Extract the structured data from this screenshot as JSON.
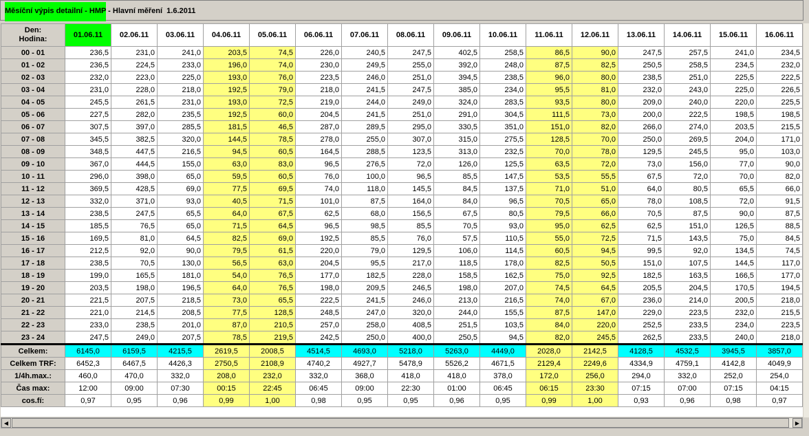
{
  "window": {
    "title_hl": "Měsíční výpis detailní - HMP",
    "title_rest": " - Hlavní měření  1.6.2011"
  },
  "corner": {
    "line1": "Den:",
    "line2": "Hodina:"
  },
  "dates": [
    "01.06.11",
    "02.06.11",
    "03.06.11",
    "04.06.11",
    "05.06.11",
    "06.06.11",
    "07.06.11",
    "08.06.11",
    "09.06.11",
    "10.06.11",
    "11.06.11",
    "12.06.11",
    "13.06.11",
    "14.06.11",
    "15.06.11",
    "16.06.11"
  ],
  "highlight": {
    "today_index": 0,
    "weekend_indices": [
      3,
      4,
      10,
      11
    ]
  },
  "colors": {
    "today": "#00ff00",
    "weekend": "#ffff80",
    "summary": "#00ffff"
  },
  "hours": [
    "00 - 01",
    "01 - 02",
    "02 - 03",
    "03 - 04",
    "04 - 05",
    "05 - 06",
    "06 - 07",
    "07 - 08",
    "08 - 09",
    "09 - 10",
    "10 - 11",
    "11 - 12",
    "12 - 13",
    "13 - 14",
    "14 - 15",
    "15 - 16",
    "16 - 17",
    "17 - 18",
    "18 - 19",
    "19 - 20",
    "20 - 21",
    "21 - 22",
    "22 - 23",
    "23 - 24"
  ],
  "values": [
    [
      "236,5",
      "231,0",
      "241,0",
      "203,5",
      "74,5",
      "226,0",
      "240,5",
      "247,5",
      "402,5",
      "258,5",
      "86,5",
      "90,0",
      "247,5",
      "257,5",
      "241,0",
      "234,5"
    ],
    [
      "236,5",
      "224,5",
      "233,0",
      "196,0",
      "74,0",
      "230,0",
      "249,5",
      "255,0",
      "392,0",
      "248,0",
      "87,5",
      "82,5",
      "250,5",
      "258,5",
      "234,5",
      "232,0"
    ],
    [
      "232,0",
      "223,0",
      "225,0",
      "193,0",
      "76,0",
      "223,5",
      "246,0",
      "251,0",
      "394,5",
      "238,5",
      "96,0",
      "80,0",
      "238,5",
      "251,0",
      "225,5",
      "222,5"
    ],
    [
      "231,0",
      "228,0",
      "218,0",
      "192,5",
      "79,0",
      "218,0",
      "241,5",
      "247,5",
      "385,0",
      "234,0",
      "95,5",
      "81,0",
      "232,0",
      "243,0",
      "225,0",
      "226,5"
    ],
    [
      "245,5",
      "261,5",
      "231,0",
      "193,0",
      "72,5",
      "219,0",
      "244,0",
      "249,0",
      "324,0",
      "283,5",
      "93,5",
      "80,0",
      "209,0",
      "240,0",
      "220,0",
      "225,5"
    ],
    [
      "227,5",
      "282,0",
      "235,5",
      "192,5",
      "60,0",
      "204,5",
      "241,5",
      "251,0",
      "291,0",
      "304,5",
      "111,5",
      "73,0",
      "200,0",
      "222,5",
      "198,5",
      "198,5"
    ],
    [
      "307,5",
      "397,0",
      "285,5",
      "181,5",
      "46,5",
      "287,0",
      "289,5",
      "295,0",
      "330,5",
      "351,0",
      "151,0",
      "82,0",
      "266,0",
      "274,0",
      "203,5",
      "215,5"
    ],
    [
      "345,5",
      "382,5",
      "320,0",
      "144,5",
      "78,5",
      "278,0",
      "255,0",
      "307,0",
      "315,0",
      "275,5",
      "128,5",
      "70,0",
      "250,0",
      "269,5",
      "204,0",
      "171,0"
    ],
    [
      "348,5",
      "447,5",
      "216,5",
      "94,5",
      "60,5",
      "164,5",
      "288,5",
      "123,5",
      "313,0",
      "232,5",
      "70,0",
      "78,0",
      "129,5",
      "245,5",
      "95,0",
      "103,0"
    ],
    [
      "367,0",
      "444,5",
      "155,0",
      "63,0",
      "83,0",
      "96,5",
      "276,5",
      "72,0",
      "126,0",
      "125,5",
      "63,5",
      "72,0",
      "73,0",
      "156,0",
      "77,0",
      "90,0"
    ],
    [
      "296,0",
      "398,0",
      "65,0",
      "59,5",
      "60,5",
      "76,0",
      "100,0",
      "96,5",
      "85,5",
      "147,5",
      "53,5",
      "55,5",
      "67,5",
      "72,0",
      "70,0",
      "82,0"
    ],
    [
      "369,5",
      "428,5",
      "69,0",
      "77,5",
      "69,5",
      "74,0",
      "118,0",
      "145,5",
      "84,5",
      "137,5",
      "71,0",
      "51,0",
      "64,0",
      "80,5",
      "65,5",
      "66,0"
    ],
    [
      "332,0",
      "371,0",
      "93,0",
      "40,5",
      "71,5",
      "101,0",
      "87,5",
      "164,0",
      "84,0",
      "96,5",
      "70,5",
      "65,0",
      "78,0",
      "108,5",
      "72,0",
      "91,5"
    ],
    [
      "238,5",
      "247,5",
      "65,5",
      "64,0",
      "67,5",
      "62,5",
      "68,0",
      "156,5",
      "67,5",
      "80,5",
      "79,5",
      "66,0",
      "70,5",
      "87,5",
      "90,0",
      "87,5"
    ],
    [
      "185,5",
      "76,5",
      "65,0",
      "71,5",
      "64,5",
      "96,5",
      "98,5",
      "85,5",
      "70,5",
      "93,0",
      "95,0",
      "62,5",
      "62,5",
      "151,0",
      "126,5",
      "88,5"
    ],
    [
      "169,5",
      "81,0",
      "64,5",
      "82,5",
      "69,0",
      "192,5",
      "85,5",
      "76,0",
      "57,5",
      "110,5",
      "55,0",
      "72,5",
      "71,5",
      "143,5",
      "75,0",
      "84,5"
    ],
    [
      "212,5",
      "92,0",
      "90,0",
      "79,5",
      "61,5",
      "220,0",
      "79,0",
      "129,5",
      "106,0",
      "114,5",
      "60,5",
      "94,5",
      "99,5",
      "92,0",
      "134,5",
      "74,5"
    ],
    [
      "238,5",
      "70,5",
      "130,0",
      "56,5",
      "63,0",
      "204,5",
      "95,5",
      "217,0",
      "118,5",
      "178,0",
      "82,5",
      "50,5",
      "151,0",
      "107,5",
      "144,5",
      "117,0"
    ],
    [
      "199,0",
      "165,5",
      "181,0",
      "54,0",
      "76,5",
      "177,0",
      "182,5",
      "228,0",
      "158,5",
      "162,5",
      "75,0",
      "92,5",
      "182,5",
      "163,5",
      "166,5",
      "177,0"
    ],
    [
      "203,5",
      "198,0",
      "196,5",
      "64,0",
      "76,5",
      "198,0",
      "209,5",
      "246,5",
      "198,0",
      "207,0",
      "74,5",
      "64,5",
      "205,5",
      "204,5",
      "170,5",
      "194,5"
    ],
    [
      "221,5",
      "207,5",
      "218,5",
      "73,0",
      "65,5",
      "222,5",
      "241,5",
      "246,0",
      "213,0",
      "216,5",
      "74,0",
      "67,0",
      "236,0",
      "214,0",
      "200,5",
      "218,0"
    ],
    [
      "221,0",
      "214,5",
      "208,5",
      "77,5",
      "128,5",
      "248,5",
      "247,0",
      "320,0",
      "244,0",
      "155,5",
      "87,5",
      "147,0",
      "229,0",
      "223,5",
      "232,0",
      "215,5"
    ],
    [
      "233,0",
      "238,5",
      "201,0",
      "87,0",
      "210,5",
      "257,0",
      "258,0",
      "408,5",
      "251,5",
      "103,5",
      "84,0",
      "220,0",
      "252,5",
      "233,5",
      "234,0",
      "223,5"
    ],
    [
      "247,5",
      "249,0",
      "207,5",
      "78,5",
      "219,5",
      "242,5",
      "250,0",
      "400,0",
      "250,5",
      "94,5",
      "82,0",
      "245,5",
      "262,5",
      "233,5",
      "240,0",
      "218,0"
    ]
  ],
  "summary": [
    {
      "label": "Celkem:",
      "values": [
        "6145,0",
        "6159,5",
        "4215,5",
        "2619,5",
        "2008,5",
        "4514,5",
        "4693,0",
        "5218,0",
        "5263,0",
        "4449,0",
        "2028,0",
        "2142,5",
        "4128,5",
        "4532,5",
        "3945,5",
        "3857,0"
      ]
    },
    {
      "label": "Celkem TRF:",
      "values": [
        "6452,3",
        "6467,5",
        "4426,3",
        "2750,5",
        "2108,9",
        "4740,2",
        "4927,7",
        "5478,9",
        "5526,2",
        "4671,5",
        "2129,4",
        "2249,6",
        "4334,9",
        "4759,1",
        "4142,8",
        "4049,9"
      ]
    },
    {
      "label": "1/4h.max.:",
      "values": [
        "460,0",
        "470,0",
        "332,0",
        "208,0",
        "232,0",
        "332,0",
        "368,0",
        "418,0",
        "418,0",
        "378,0",
        "172,0",
        "256,0",
        "294,0",
        "332,0",
        "252,0",
        "254,0"
      ]
    },
    {
      "label": "Čas max:",
      "values": [
        "12:00",
        "09:00",
        "07:30",
        "00:15",
        "22:45",
        "06:45",
        "09:00",
        "22:30",
        "01:00",
        "06:45",
        "06:15",
        "23:30",
        "07:15",
        "07:00",
        "07:15",
        "04:15"
      ]
    },
    {
      "label": "cos.fí:",
      "values": [
        "0,97",
        "0,95",
        "0,96",
        "0,99",
        "1,00",
        "0,98",
        "0,95",
        "0,95",
        "0,96",
        "0,95",
        "0,99",
        "1,00",
        "0,93",
        "0,96",
        "0,98",
        "0,97"
      ]
    }
  ]
}
